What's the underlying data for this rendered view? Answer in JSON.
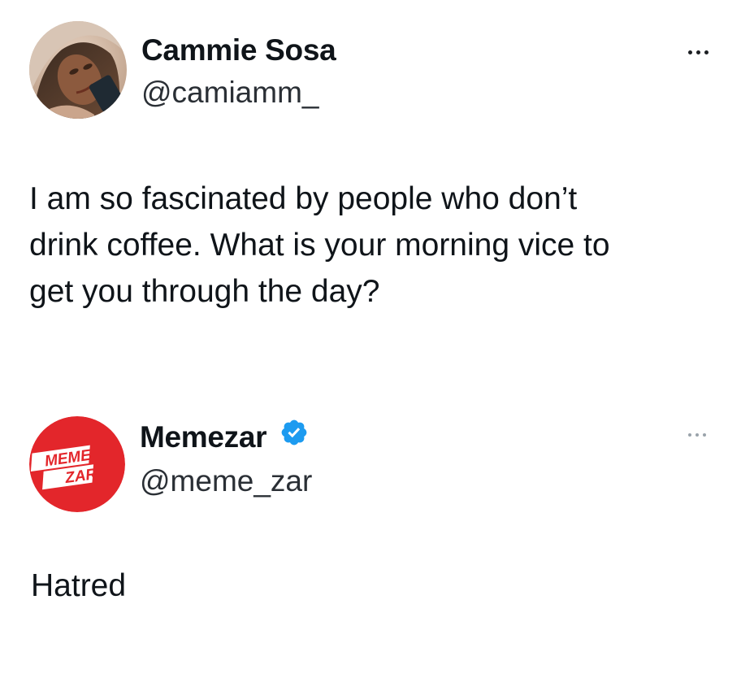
{
  "tweet": {
    "author": {
      "name": "Cammie Sosa",
      "handle": "@camiamm_",
      "avatar_icon": "profile-photo"
    },
    "text_lines": [
      "I am so fascinated by people who don’t",
      "drink coffee. What is your morning vice to",
      "get you through the day?"
    ],
    "more_icon": "more-options-icon"
  },
  "reply": {
    "author": {
      "name": "Memezar",
      "handle": "@meme_zar",
      "verified": true,
      "avatar_icon": "memezar-logo",
      "logo_text": [
        "MEME",
        "ZAR"
      ]
    },
    "text": "Hatred",
    "more_icon": "more-options-icon"
  },
  "colors": {
    "text": "#0f1419",
    "verified_badge": "#1d9bf0",
    "memezar_red": "#e3262b"
  }
}
